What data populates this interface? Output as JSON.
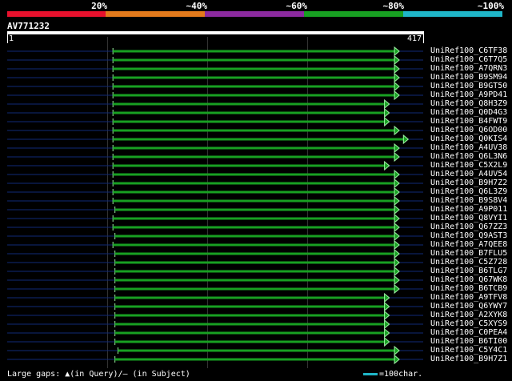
{
  "legend": {
    "segments": [
      {
        "color": "#e8112d",
        "frac": 0.198
      },
      {
        "color": "#e37a1c",
        "frac": 0.2
      },
      {
        "color": "#8c2a9f",
        "frac": 0.2
      },
      {
        "color": "#18a022",
        "frac": 0.2
      },
      {
        "color": "#1fb6c8",
        "frac": 0.2
      }
    ],
    "labels": [
      "20%",
      "~40%",
      "~60%",
      "~80%",
      "~100%"
    ]
  },
  "query": {
    "name": "AV771232",
    "start": "1",
    "end": "417",
    "length": 417
  },
  "hits": [
    {
      "label": "UniRef100_C6TF38",
      "qs": 106,
      "qe": 393
    },
    {
      "label": "UniRef100_C6T7Q5",
      "qs": 106,
      "qe": 393
    },
    {
      "label": "UniRef100_A7QRN3",
      "qs": 106,
      "qe": 393
    },
    {
      "label": "UniRef100_B9SM94",
      "qs": 106,
      "qe": 393
    },
    {
      "label": "UniRef100_B9GT50",
      "qs": 106,
      "qe": 393
    },
    {
      "label": "UniRef100_A9PD41",
      "qs": 106,
      "qe": 393
    },
    {
      "label": "UniRef100_Q8H3Z9",
      "qs": 106,
      "qe": 383
    },
    {
      "label": "UniRef100_Q0D4G3",
      "qs": 106,
      "qe": 383
    },
    {
      "label": "UniRef100_B4FWT9",
      "qs": 106,
      "qe": 383
    },
    {
      "label": "UniRef100_Q6OD00",
      "qs": 106,
      "qe": 393
    },
    {
      "label": "UniRef100_Q0KIS4",
      "qs": 106,
      "qe": 402
    },
    {
      "label": "UniRef100_A4UV38",
      "qs": 106,
      "qe": 393
    },
    {
      "label": "UniRef100_Q6L3N6",
      "qs": 106,
      "qe": 393
    },
    {
      "label": "UniRef100_C5X2L9",
      "qs": 106,
      "qe": 383
    },
    {
      "label": "UniRef100_A4UV54",
      "qs": 106,
      "qe": 393
    },
    {
      "label": "UniRef100_B9H7Z2",
      "qs": 106,
      "qe": 393
    },
    {
      "label": "UniRef100_Q6L3Z9",
      "qs": 106,
      "qe": 393
    },
    {
      "label": "UniRef100_B9S8V4",
      "qs": 106,
      "qe": 393
    },
    {
      "label": "UniRef100_A9P011",
      "qs": 108,
      "qe": 393
    },
    {
      "label": "UniRef100_Q8VYI1",
      "qs": 106,
      "qe": 393
    },
    {
      "label": "UniRef100_Q67ZZ3",
      "qs": 106,
      "qe": 393
    },
    {
      "label": "UniRef100_Q9AST3",
      "qs": 108,
      "qe": 393
    },
    {
      "label": "UniRef100_A7QEE8",
      "qs": 106,
      "qe": 393
    },
    {
      "label": "UniRef100_B7FLU5",
      "qs": 108,
      "qe": 393
    },
    {
      "label": "UniRef100_C5Z728",
      "qs": 108,
      "qe": 393
    },
    {
      "label": "UniRef100_B6TLG7",
      "qs": 108,
      "qe": 393
    },
    {
      "label": "UniRef100_Q67WK8",
      "qs": 108,
      "qe": 393
    },
    {
      "label": "UniRef100_B6TCB9",
      "qs": 108,
      "qe": 393
    },
    {
      "label": "UniRef100_A9TFV8",
      "qs": 108,
      "qe": 383
    },
    {
      "label": "UniRef100_Q6YWY7",
      "qs": 108,
      "qe": 383
    },
    {
      "label": "UniRef100_A2XYK8",
      "qs": 108,
      "qe": 383
    },
    {
      "label": "UniRef100_C5XYS9",
      "qs": 108,
      "qe": 383
    },
    {
      "label": "UniRef100_C0PEA4",
      "qs": 108,
      "qe": 383
    },
    {
      "label": "UniRef100_B6TI00",
      "qs": 108,
      "qe": 383
    },
    {
      "label": "UniRef100_C5Y4C1",
      "qs": 111,
      "qe": 393
    },
    {
      "label": "UniRef100_B9H7Z1",
      "qs": 108,
      "qe": 393
    }
  ],
  "footer": {
    "text": "Large gaps: ▲(in Query)/— (in Subject)"
  },
  "scale": {
    "text": "=100char."
  },
  "colors": {
    "hit": "#18a022",
    "line": "#102a78",
    "arrow": "#9ff3a6",
    "grid": "#333333"
  }
}
